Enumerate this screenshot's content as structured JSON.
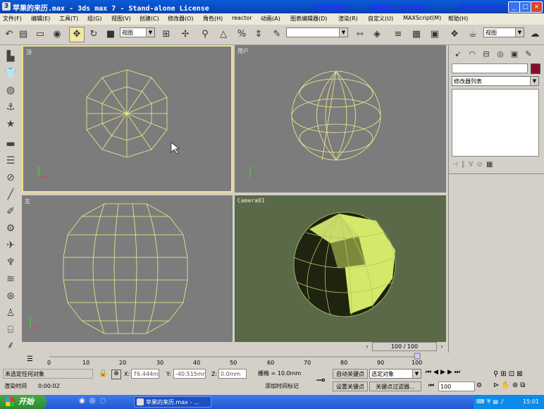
{
  "window": {
    "title": "苹果的来历.max - 3ds max 7 - Stand-alone License",
    "icon": "3ds-max-icon",
    "buttons": [
      "_",
      "□",
      "×"
    ]
  },
  "watermark": {
    "left": "大羊美艺术",
    "middle": "班在线上学习平台",
    "site": "dayangmei.cn"
  },
  "menu": [
    "文件(F)",
    "编辑(E)",
    "工具(T)",
    "组(G)",
    "视图(V)",
    "创建(C)",
    "修改器(O)",
    "角色(H)",
    "reactor",
    "动画(A)",
    "图表编辑器(D)",
    "渲染(R)",
    "自定义(U)",
    "MAXScript(M)",
    "帮助(H)"
  ],
  "toolbar": {
    "selection_filter": "视图",
    "named_selection": "",
    "coord_system": "视图",
    "icons": [
      "select-icon",
      "select-by-name-icon",
      "rect-select-icon",
      "window-crossing-icon",
      "move-icon",
      "rotate-icon",
      "scale-icon",
      "pivot-icon",
      "mirror-icon",
      "align-icon",
      "layer-icon",
      "curve-editor-icon",
      "schematic-icon",
      "material-editor-icon",
      "render-scene-icon",
      "quick-render-icon"
    ]
  },
  "viewports": {
    "top": "顶",
    "user": "用户",
    "left": "左",
    "camera": "Camera01"
  },
  "command_panel": {
    "object_name": "",
    "color": "#8b0c2e",
    "modifier_list": "修改器列表"
  },
  "timeline": {
    "frame_display": "100 / 100",
    "ticks": [
      "0",
      "10",
      "20",
      "30",
      "40",
      "50",
      "60",
      "70",
      "80",
      "90",
      "100"
    ],
    "current_frame": 100,
    "total_frames": 100
  },
  "status": {
    "selection": "未选定任何对象",
    "render_time_label": "渲染时间",
    "render_time": "0:00:02",
    "x_label": "X:",
    "x_value": "76.444mm",
    "y_label": "Y:",
    "y_value": "-40.515mm",
    "z_label": "Z:",
    "z_value": "0.0mm",
    "grid": "栅格 = 10.0mm",
    "add_time_tag": "添加时间标记",
    "auto_key": "自动关键点",
    "set_key": "设置关键点",
    "selected_object": "选定对象",
    "key_filters": "关键点过滤器...",
    "frame_field": "100"
  },
  "taskbar": {
    "start": "开始",
    "task": "苹果的来历.max - ...",
    "clock": "15:01"
  }
}
